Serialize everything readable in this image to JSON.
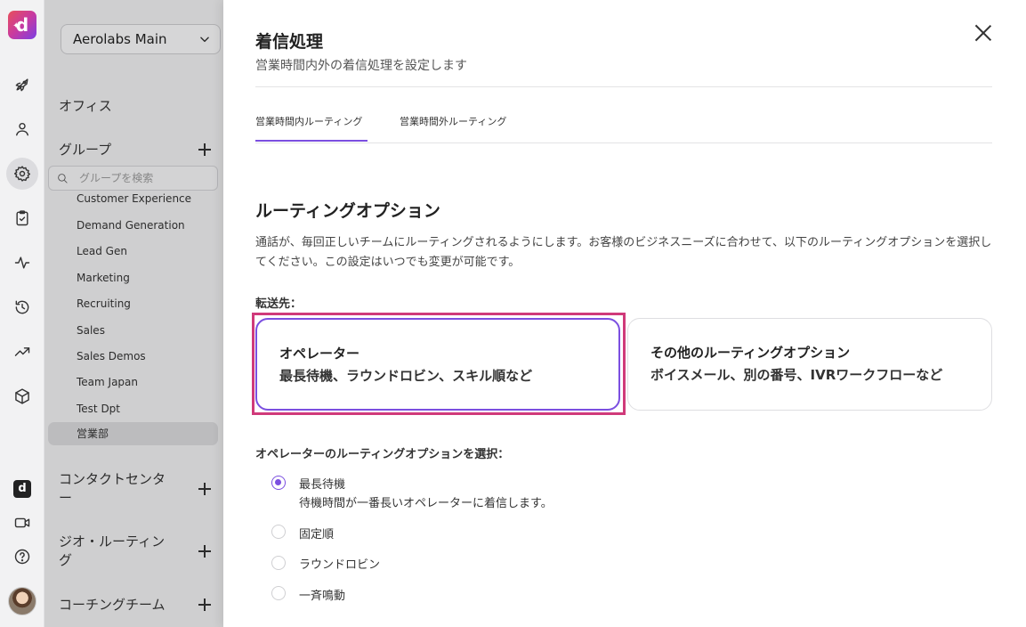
{
  "sidebar": {
    "org_name": "Aerolabs Main",
    "office_label": "オフィス",
    "groups_label": "グループ",
    "search_placeholder": "グループを検索",
    "groups": [
      "Customer Experience",
      "Demand Generation",
      "Lead Gen",
      "Marketing",
      "Recruiting",
      "Sales",
      "Sales Demos",
      "Team Japan",
      "Test Dpt",
      "営業部"
    ],
    "selected_group": "営業部",
    "contact_center_label": "コンタクトセンター",
    "geo_routing_label": "ジオ・ルーティング",
    "coaching_team_label": "コーチングチーム"
  },
  "rail_icons": [
    "rocket-icon",
    "person-icon",
    "settings-icon",
    "clipboard-check-icon",
    "activity-icon",
    "history-icon",
    "trending-icon",
    "cube-icon",
    "dialpad-app-icon",
    "video-icon",
    "help-icon"
  ],
  "drawer": {
    "title": "着信処理",
    "subtitle": "営業時間内外の着信処理を設定します",
    "tabs": [
      "営業時間内ルーティング",
      "営業時間外ルーティング"
    ],
    "active_tab": "営業時間内ルーティング",
    "section_title": "ルーティングオプション",
    "section_desc": "通話が、毎回正しいチームにルーティングされるようにします。お客様のビジネスニーズに合わせて、以下のルーティングオプションを選択してください。この設定はいつでも変更が可能です。",
    "transfer_label": "転送先：",
    "cards": [
      {
        "title": "オペレーター",
        "desc": "最長待機、ラウンドロビン、スキル順など",
        "selected": true
      },
      {
        "title": "その他のルーティングオプション",
        "desc": "ボイスメール、別の番号、IVRワークフローなど",
        "selected": false
      }
    ],
    "operator_options_label": "オペレーターのルーティングオプションを選択：",
    "options": [
      {
        "label": "最長待機",
        "desc": "待機時間が一番長いオペレーターに着信します。",
        "selected": true
      },
      {
        "label": "固定順",
        "selected": false
      },
      {
        "label": "ラウンドロビン",
        "selected": false
      },
      {
        "label": "一斉鳴動",
        "selected": false
      }
    ]
  },
  "colors": {
    "accent": "#7b4fe0",
    "highlight_border": "#d03a7a"
  }
}
